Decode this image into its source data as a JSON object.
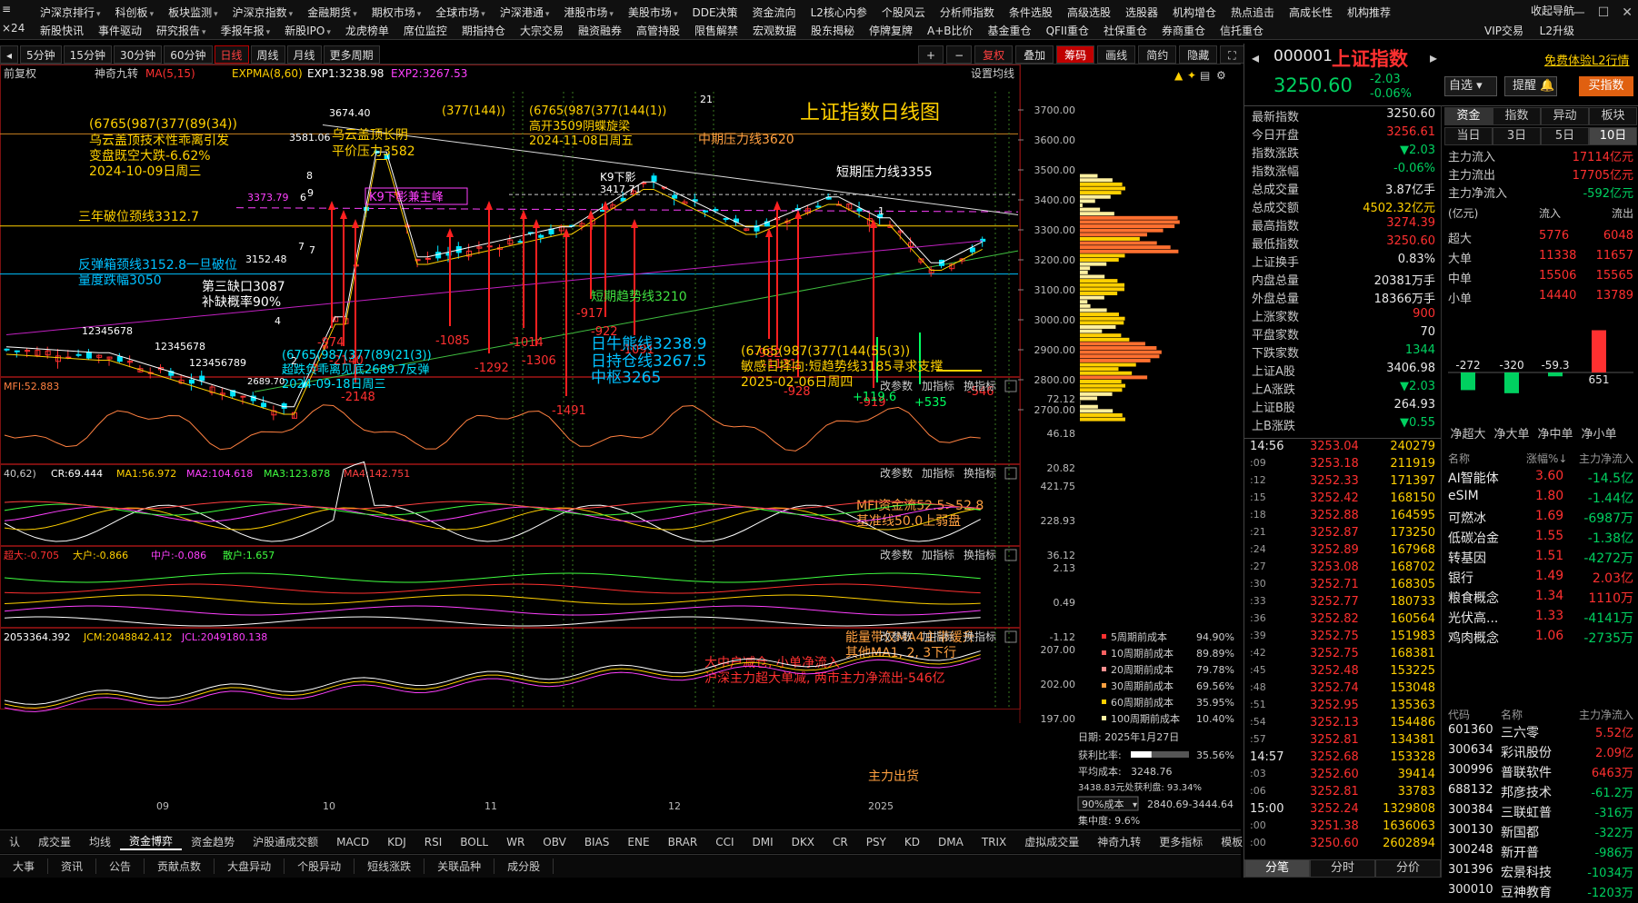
{
  "topnav": {
    "row1": [
      "沪深京排行",
      "科创板",
      "板块监测",
      "沪深京指数",
      "金融期货",
      "期权市场",
      "全球市场",
      "沪深港通",
      "港股市场",
      "美股市场",
      "DDE决策",
      "资金流向",
      "L2核心内参",
      "个股风云",
      "分析师指数",
      "条件选股",
      "高级选股",
      "选股器",
      "机构增仓",
      "热点追击",
      "高成长性",
      "机构推荐"
    ],
    "row2": [
      "新股快讯",
      "事件驱动",
      "研究报告",
      "季报年报",
      "新股IPO",
      "龙虎榜单",
      "席位监控",
      "期指持仓",
      "大宗交易",
      "融资融券",
      "高管持股",
      "限售解禁",
      "宏观数据",
      "股东揭秘",
      "停牌复牌",
      "A+B比价",
      "基金重仓",
      "QFII重仓",
      "社保重仓",
      "券商重仓",
      "信托重仓"
    ],
    "right": [
      "收起导航",
      "VIP交易",
      "L2升级"
    ]
  },
  "periods": [
    "5分钟",
    "15分钟",
    "30分钟",
    "60分钟",
    "日线",
    "周线",
    "月线",
    "更多周期"
  ],
  "active_period": "日线",
  "tools": [
    "+",
    "−",
    "复权",
    "叠加",
    "筹码",
    "画线",
    "简约",
    "隐藏"
  ],
  "legend_main": {
    "rights": "前复权",
    "indicator": "神奇九转",
    "ma": "MA(5,15)",
    "expma": "EXPMA(8,60)",
    "exp1": "EXP1:3238.98",
    "exp2": "EXP2:3267.53",
    "settings": "设置均线"
  },
  "price_axis": [
    "3700.00",
    "3600.00",
    "3500.00",
    "3400.00",
    "3300.00",
    "3200.00",
    "3100.00",
    "3000.00",
    "2900.00",
    "2800.00",
    "2700.00"
  ],
  "annotations": {
    "title": "上证指数日线图",
    "a1": "(6765(987(377(89(34))",
    "a2": "乌云盖顶技术性乖离引发",
    "a3": "变盘既空大跌-6.62%",
    "a4": "2024-10-09日周三",
    "a5": "乌云盖顶长阴",
    "a6": "平价压力3582",
    "a7": "(377(144))",
    "a8": "(6765(987(377(144(1))",
    "a9": "高开3509阴蝶旋梁",
    "a10": "2024-11-08日周五",
    "a11": "中期压力线3620",
    "a12": "K9下影",
    "a13": "3417.71",
    "a14": "K9下影兼主峰",
    "a15": "3373.79",
    "a16": "短期压力线3355",
    "a17": "三年破位颈线3312.7",
    "a18": "反弹箱颈线3152.8一旦破位",
    "a19": "量度跌幅3050",
    "a20": "3152.48",
    "a21": "第三缺口3087",
    "a22": "补缺概率90%",
    "a23": "短期趋势线3210",
    "a24": "(6765(987(377(89(21(3))",
    "a25": "超跌负乖离见底2689.7反弹",
    "a26": "2024-09-18日周三",
    "a27": "2689.70",
    "a28": "日牛熊线3238.9",
    "a29": "日持仓线3267.5",
    "a30": "中枢3265",
    "a31": "(6765(987(377(144(55(3))",
    "a32": "敏感日择向:短趋势线3185寻求支撑",
    "a33": "2025-02-06日周四",
    "a34": "3674.40",
    "a35": "3581.06",
    "nums": [
      "-974",
      "-2140",
      "-2148",
      "-1085",
      "-1292",
      "-1014",
      "-1306",
      "-1491",
      "-922",
      "-917",
      "-1091",
      "-982",
      "-1131",
      "-928",
      "-919",
      "+119.6",
      "+535",
      "-546"
    ],
    "seq": "12345678",
    "seq2": "123456789",
    "small": [
      "21",
      "8",
      "9",
      "2",
      "6",
      "7",
      "7",
      "4",
      "1"
    ]
  },
  "mfi": {
    "label": "MFI:52.883",
    "axis": [
      "72.12",
      "46.18",
      "20.82"
    ],
    "note1": "MFI资金流52.5>52.8",
    "note2": "基准线50.0上弱盘"
  },
  "cr": {
    "label0": "40,62)",
    "cr": "CR:69.444",
    "ma1": "MA1:56.972",
    "ma2": "MA2:104.618",
    "ma3": "MA3:123.878",
    "ma4": "MA4:142.751",
    "axis": [
      "421.75",
      "228.93",
      "36.12"
    ],
    "note1": "能量带仅MA4主带缓升",
    "note2": "其他MA1, 2, 3下行"
  },
  "fund": {
    "l0": "超大:-0.705",
    "l1": "大户:-0.866",
    "l2": "中户:-0.086",
    "l3": "散户:1.657",
    "axis": [
      "2.13",
      "0.49",
      "-1.12"
    ],
    "note1": "大中户减仓, 小单净流入",
    "note2": "沪深主力超大单减, 两市主力净流出-546亿"
  },
  "jcm": {
    "l0": "2053364.392",
    "l1": "JCM:2048842.412",
    "l2": "JCL:2049180.138",
    "axis": [
      "207.00",
      "202.00",
      "197.00"
    ],
    "note": "主力出货"
  },
  "panel_btns": [
    "改参数",
    "加指标",
    "换指标"
  ],
  "xaxis": [
    "09",
    "10",
    "11",
    "12",
    "2025"
  ],
  "chips": {
    "rows": [
      {
        "l": "5周期前成本",
        "v": "94.90%",
        "c": "#ff3030"
      },
      {
        "l": "10周期前成本",
        "v": "89.89%",
        "c": "#ff6060"
      },
      {
        "l": "20周期前成本",
        "v": "79.78%",
        "c": "#ff9090"
      },
      {
        "l": "30周期前成本",
        "v": "69.56%",
        "c": "#ffa040"
      },
      {
        "l": "60周期前成本",
        "v": "35.95%",
        "c": "#ffd000"
      },
      {
        "l": "100周期前成本",
        "v": "10.40%",
        "c": "#fff0a0"
      }
    ],
    "date": "日期: 2025年1月27日",
    "profit_label": "获利比率:",
    "profit": "35.56%",
    "avg_label": "平均成本:",
    "avg": "3248.76",
    "chip_note": "3438.83元处获利盘: 93.34%",
    "sel": "90%成本",
    "range": "2840.69-3444.64",
    "conc": "集中度: 9.6%"
  },
  "quote": {
    "code": "000001",
    "name": "上证指数",
    "link": "免费体验L2行情",
    "price": "3250.60",
    "chg": "-2.03",
    "pct": "-0.06%",
    "btn1": "自选",
    "btn2": "提醒",
    "btn3": "买指数"
  },
  "stats": [
    {
      "k": "最新指数",
      "v": "3250.60",
      "c": "w"
    },
    {
      "k": "今日开盘",
      "v": "3256.61",
      "c": "r"
    },
    {
      "k": "指数涨跌",
      "v": "▼2.03",
      "c": "g"
    },
    {
      "k": "指数涨幅",
      "v": "-0.06%",
      "c": "g"
    },
    {
      "k": "总成交量",
      "v": "3.87亿手",
      "c": "w"
    },
    {
      "k": "总成交额",
      "v": "4502.32亿元",
      "c": "y"
    },
    {
      "k": "最高指数",
      "v": "3274.39",
      "c": "r"
    },
    {
      "k": "最低指数",
      "v": "3250.60",
      "c": "r"
    },
    {
      "k": "上证换手",
      "v": "0.83%",
      "c": "w"
    },
    {
      "k": "内盘总量",
      "v": "20381万手",
      "c": "w"
    },
    {
      "k": "外盘总量",
      "v": "18366万手",
      "c": "w"
    },
    {
      "k": "上涨家数",
      "v": "900",
      "c": "r"
    },
    {
      "k": "平盘家数",
      "v": "70",
      "c": "w"
    },
    {
      "k": "下跌家数",
      "v": "1344",
      "c": "g"
    },
    {
      "k": "上证A股",
      "v": "3406.98",
      "c": "w"
    },
    {
      "k": "上A涨跌",
      "v": "▼2.03",
      "c": "g"
    },
    {
      "k": "上证B股",
      "v": "264.93",
      "c": "w"
    },
    {
      "k": "上B涨跌",
      "v": "▼0.55",
      "c": "g"
    }
  ],
  "fundtabs": [
    "资金",
    "指数",
    "异动",
    "板块"
  ],
  "daytabs": [
    "当日",
    "3日",
    "5日",
    "10日"
  ],
  "flow": [
    {
      "k": "主力流入",
      "v": "17114亿元",
      "c": "r"
    },
    {
      "k": "主力流出",
      "v": "17705亿元",
      "c": "r"
    },
    {
      "k": "主力净流入",
      "v": "-592亿元",
      "c": "g"
    }
  ],
  "flowhead": [
    "(亿元)",
    "流入",
    "流出"
  ],
  "flowrows": [
    {
      "k": "超大",
      "a": "5776",
      "b": "6048"
    },
    {
      "k": "大单",
      "a": "11338",
      "b": "11657"
    },
    {
      "k": "中单",
      "a": "15506",
      "b": "15565"
    },
    {
      "k": "小单",
      "a": "14440",
      "b": "13789"
    }
  ],
  "bars": {
    "values": [
      -272,
      -320,
      -59.3,
      651
    ],
    "labels": [
      "净超大",
      "净大单",
      "净中单",
      "净小单"
    ]
  },
  "sect_head": [
    "名称",
    "涨幅%↓",
    "主力净流入"
  ],
  "sectors": [
    {
      "n": "AI智能体",
      "p": "3.60",
      "f": "-14.5亿"
    },
    {
      "n": "eSIM",
      "p": "1.80",
      "f": "-1.44亿"
    },
    {
      "n": "可燃冰",
      "p": "1.69",
      "f": "-6987万"
    },
    {
      "n": "低碳冶金",
      "p": "1.55",
      "f": "-1.38亿"
    },
    {
      "n": "转基因",
      "p": "1.51",
      "f": "-4272万"
    },
    {
      "n": "银行",
      "p": "1.49",
      "f": "2.03亿"
    },
    {
      "n": "粮食概念",
      "p": "1.34",
      "f": "1110万"
    },
    {
      "n": "光伏高...",
      "p": "1.33",
      "f": "-4141万"
    },
    {
      "n": "鸡肉概念",
      "p": "1.06",
      "f": "-2735万"
    }
  ],
  "stk_head": [
    "代码",
    "名称",
    "主力净流入"
  ],
  "stocks": [
    {
      "c": "601360",
      "n": "三六零",
      "f": "5.52亿"
    },
    {
      "c": "300634",
      "n": "彩讯股份",
      "f": "2.09亿"
    },
    {
      "c": "300996",
      "n": "普联软件",
      "f": "6463万"
    },
    {
      "c": "688132",
      "n": "邦彦技术",
      "f": "-61.2万"
    },
    {
      "c": "300384",
      "n": "三联虹普",
      "f": "-316万"
    },
    {
      "c": "300130",
      "n": "新国都",
      "f": "-322万"
    },
    {
      "c": "300248",
      "n": "新开普",
      "f": "-986万"
    },
    {
      "c": "301396",
      "n": "宏景科技",
      "f": "-1034万"
    },
    {
      "c": "300010",
      "n": "豆神教育",
      "f": "-1203万"
    }
  ],
  "ticks": [
    {
      "t": "14:56",
      "p": "3253.04",
      "v": "240279"
    },
    {
      "t": ":09",
      "p": "3253.18",
      "v": "211919"
    },
    {
      "t": ":12",
      "p": "3252.33",
      "v": "171397"
    },
    {
      "t": ":15",
      "p": "3252.42",
      "v": "168150"
    },
    {
      "t": ":18",
      "p": "3252.88",
      "v": "164595"
    },
    {
      "t": ":21",
      "p": "3252.87",
      "v": "173250"
    },
    {
      "t": ":24",
      "p": "3252.89",
      "v": "167968"
    },
    {
      "t": ":27",
      "p": "3253.08",
      "v": "168702"
    },
    {
      "t": ":30",
      "p": "3252.71",
      "v": "168305"
    },
    {
      "t": ":33",
      "p": "3252.77",
      "v": "180733"
    },
    {
      "t": ":36",
      "p": "3252.82",
      "v": "160564"
    },
    {
      "t": ":39",
      "p": "3252.75",
      "v": "151983"
    },
    {
      "t": ":42",
      "p": "3252.75",
      "v": "168381"
    },
    {
      "t": ":45",
      "p": "3252.48",
      "v": "153225"
    },
    {
      "t": ":48",
      "p": "3252.74",
      "v": "153048"
    },
    {
      "t": ":51",
      "p": "3252.95",
      "v": "135363"
    },
    {
      "t": ":54",
      "p": "3252.13",
      "v": "154486"
    },
    {
      "t": ":57",
      "p": "3252.81",
      "v": "134381"
    },
    {
      "t": "14:57",
      "p": "3252.68",
      "v": "153328"
    },
    {
      "t": ":03",
      "p": "3252.60",
      "v": "39414"
    },
    {
      "t": ":06",
      "p": "3252.81",
      "v": "33783"
    },
    {
      "t": "15:00",
      "p": "3252.24",
      "v": "1329808"
    },
    {
      "t": ":00",
      "p": "3251.38",
      "v": "1636063"
    },
    {
      "t": ":00",
      "p": "3250.60",
      "v": "2602894"
    }
  ],
  "bottabs": [
    "分笔",
    "分时",
    "分价"
  ],
  "tabs1": [
    "成交量",
    "均线",
    "资金博弈",
    "资金趋势",
    "沪股通成交额",
    "MACD",
    "KDJ",
    "RSI",
    "BOLL",
    "WR",
    "OBV",
    "BIAS",
    "ENE",
    "BRAR",
    "CCI",
    "DMI",
    "DKX",
    "CR",
    "PSY",
    "KD",
    "DMA",
    "TRIX",
    "虚拟成交量",
    "神奇九转",
    "更多指标",
    "模板"
  ],
  "tabs1_pre": "认",
  "tabs2": [
    "大事",
    "资讯",
    "公告",
    "贡献点数",
    "大盘异动",
    "个股异动",
    "短线涨跌",
    "关联品种",
    "成分股"
  ]
}
